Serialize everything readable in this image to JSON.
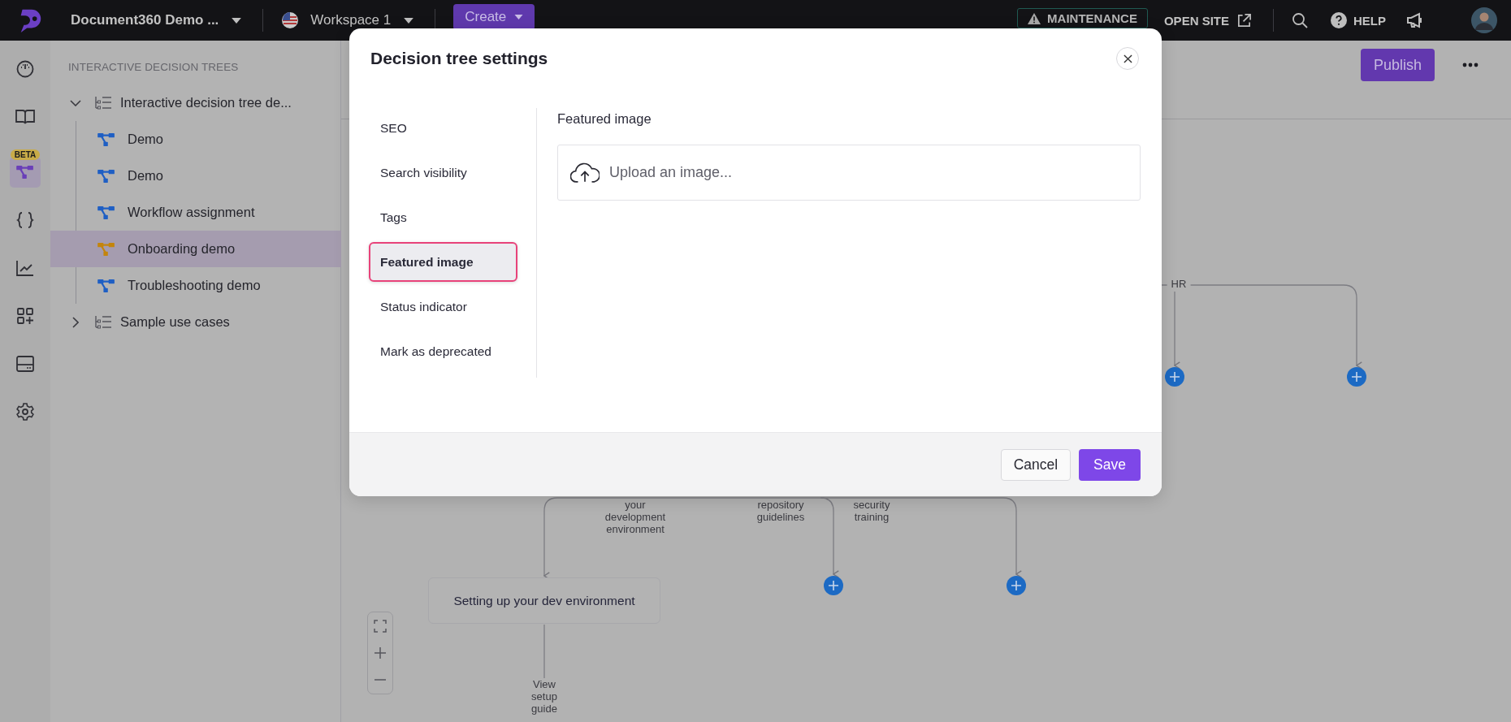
{
  "top_bar": {
    "project": "Document360 Demo ...",
    "workspace": "Workspace 1",
    "create_button": "Create",
    "maintenance_badge": "MAINTENANCE",
    "open_site_link": "OPEN SITE",
    "help_link": "HELP"
  },
  "rail": [
    {
      "kind": "dashboard",
      "selected": false
    },
    {
      "kind": "docs",
      "selected": false
    },
    {
      "kind": "decision-tree",
      "selected": true,
      "badge": "BETA"
    },
    {
      "kind": "api",
      "selected": false
    },
    {
      "kind": "analytics",
      "selected": false
    },
    {
      "kind": "apps",
      "selected": false
    },
    {
      "kind": "widget",
      "selected": false
    },
    {
      "kind": "settings",
      "selected": false
    }
  ],
  "sidebar": {
    "heading": "INTERACTIVE DECISION TREES",
    "tree": [
      {
        "label": "Interactive decision tree de...",
        "expanded": true,
        "selected": false,
        "children": [
          {
            "label": "Demo",
            "selected": false,
            "color": "#1f5fc4"
          },
          {
            "label": "Demo",
            "selected": false,
            "color": "#1f5fc4"
          },
          {
            "label": "Workflow assignment",
            "selected": false,
            "color": "#1f5fc4"
          },
          {
            "label": "Onboarding demo",
            "selected": true,
            "color": "#c4850c"
          },
          {
            "label": "Troubleshooting demo",
            "selected": false,
            "color": "#1f5fc4"
          }
        ]
      },
      {
        "label": "Sample use cases",
        "expanded": false,
        "selected": false
      }
    ]
  },
  "canvas": {
    "publish_button": "Publish",
    "edge_labels": [
      {
        "text": "HR"
      },
      {
        "text": "your development environment"
      },
      {
        "text": "repository guidelines"
      },
      {
        "text": "security training"
      },
      {
        "text": "View setup guide"
      }
    ],
    "nodes": [
      {
        "text": "Setting up your dev environment"
      }
    ]
  },
  "dialog": {
    "title": "Decision tree settings",
    "nav": [
      {
        "label": "SEO",
        "selected": false
      },
      {
        "label": "Search visibility",
        "selected": false
      },
      {
        "label": "Tags",
        "selected": false
      },
      {
        "label": "Featured image",
        "selected": true
      },
      {
        "label": "Status indicator",
        "selected": false
      },
      {
        "label": "Mark as deprecated",
        "selected": false
      }
    ],
    "section_title": "Featured image",
    "upload_label": "Upload an image...",
    "cancel_button": "Cancel",
    "save_button": "Save"
  }
}
